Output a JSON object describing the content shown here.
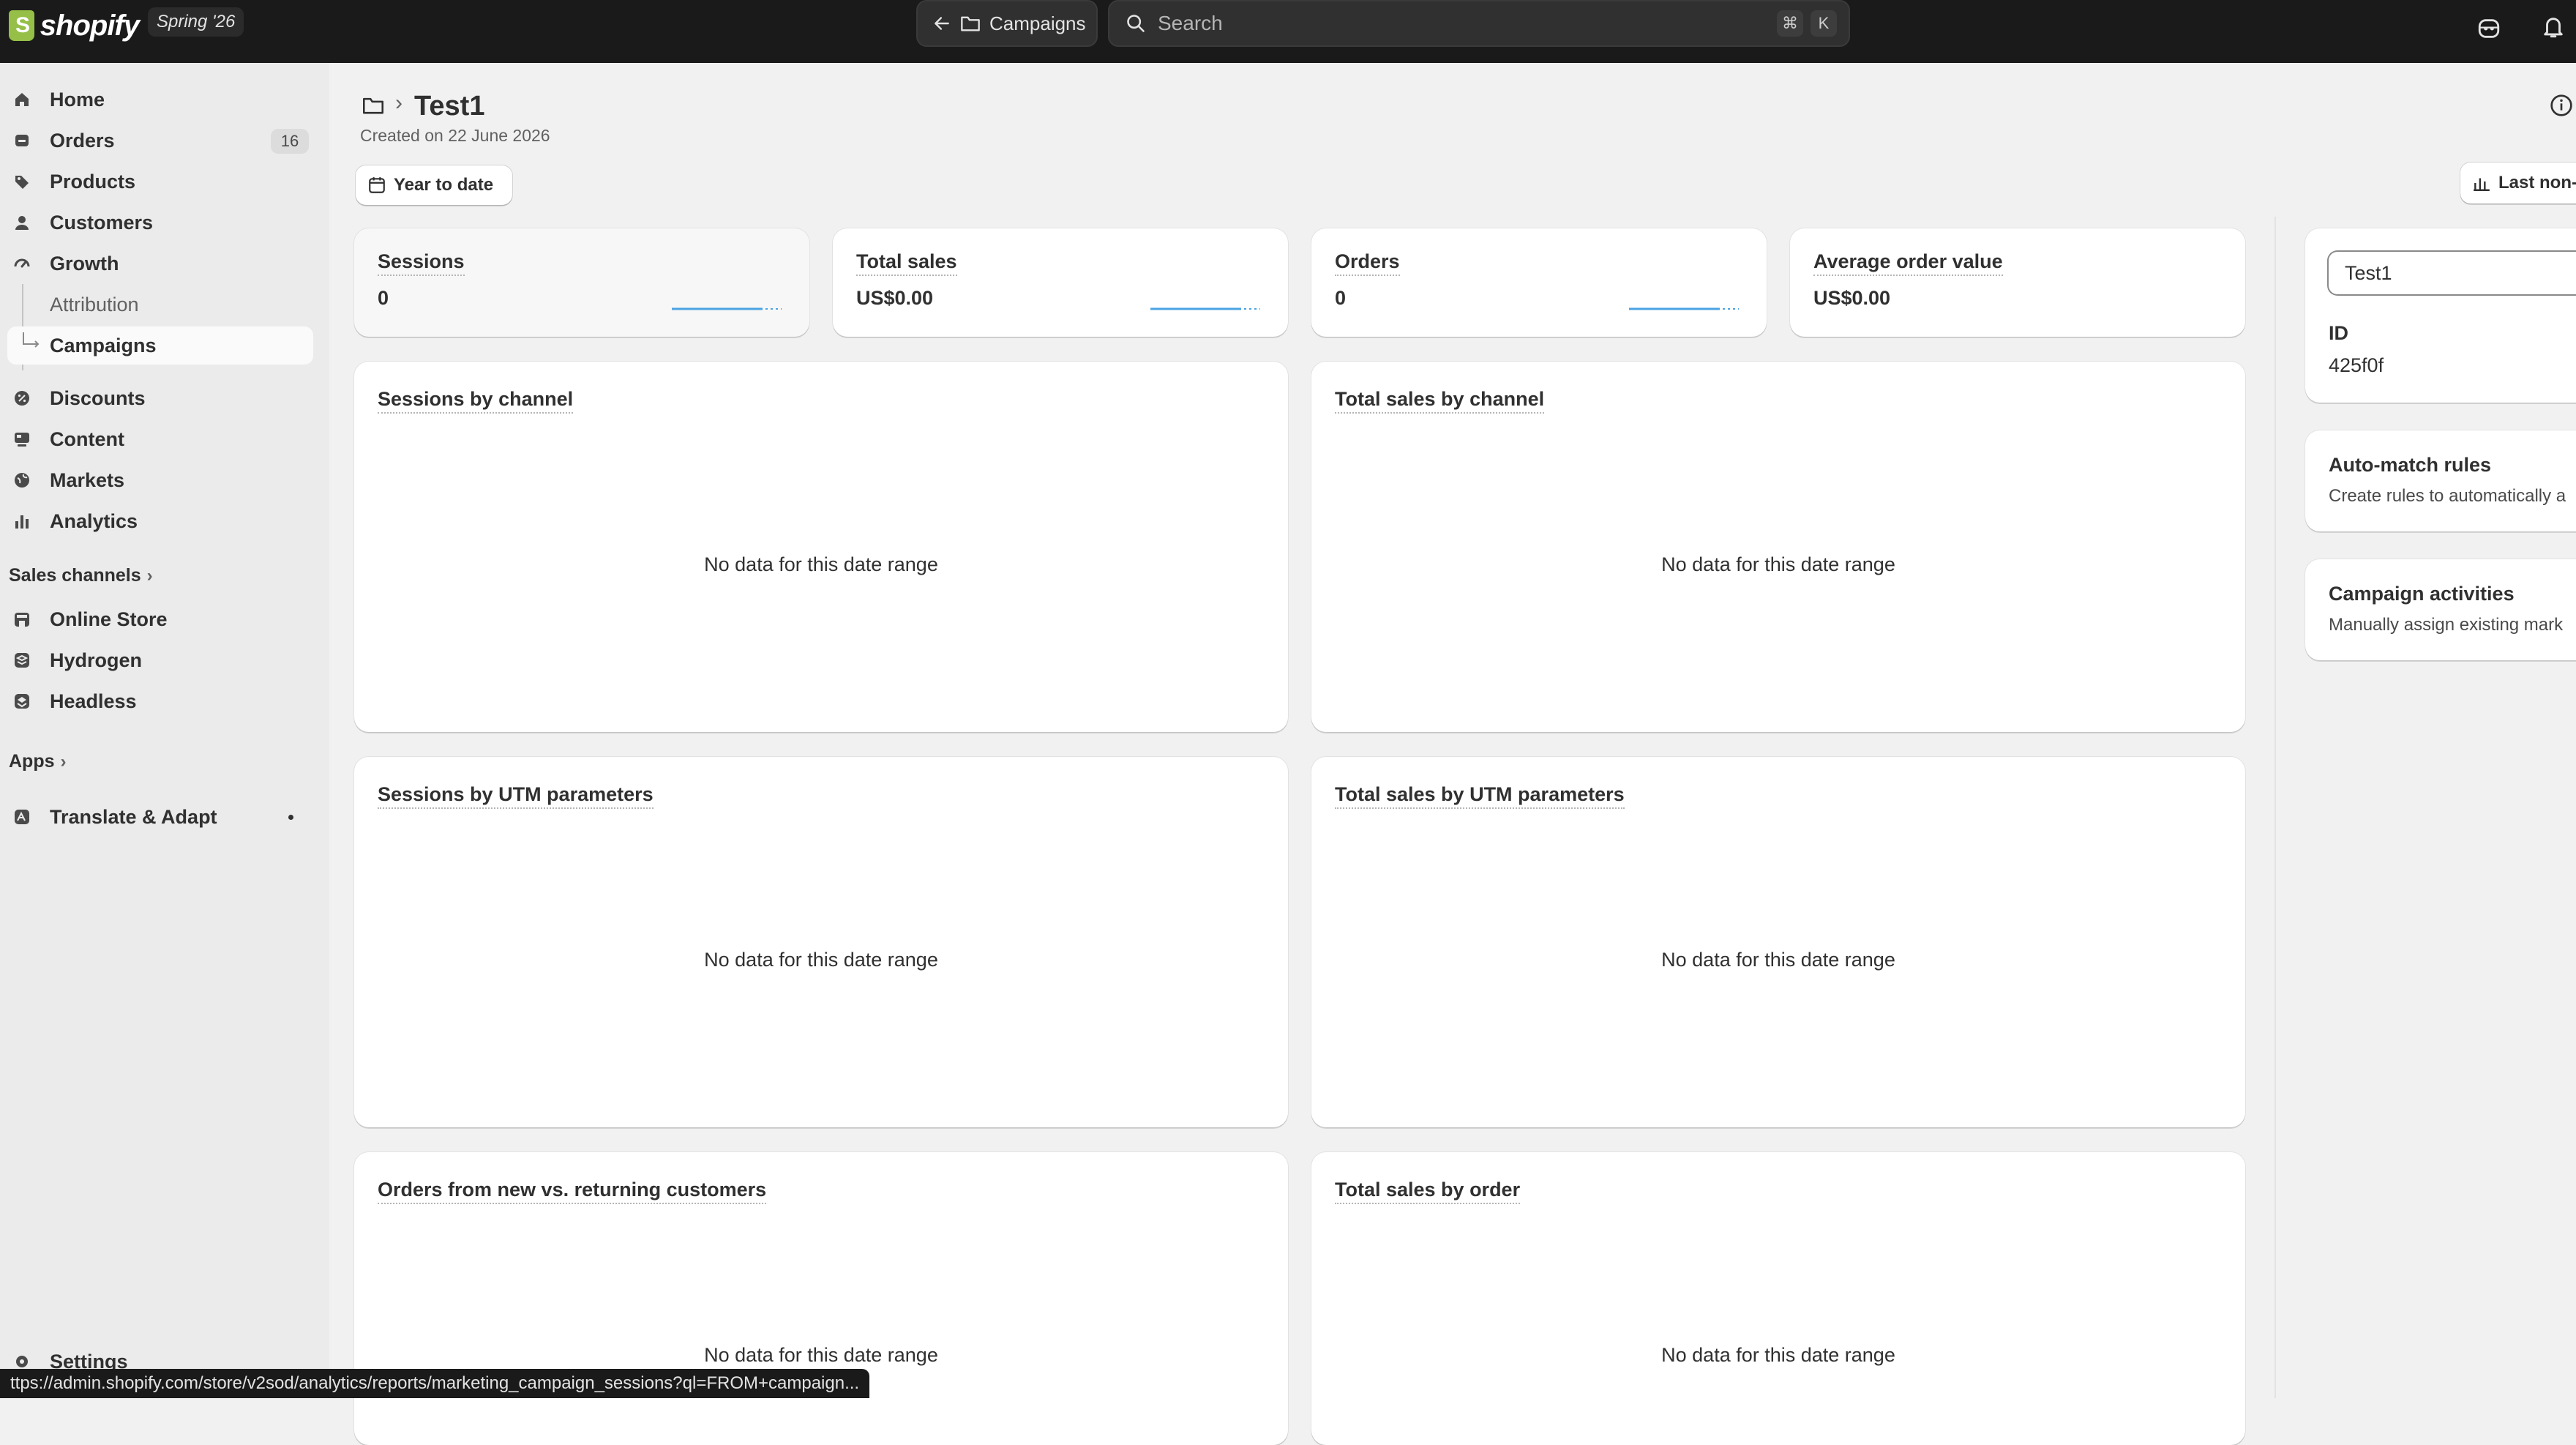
{
  "topbar": {
    "brand": "shopify",
    "edition": "Spring '26",
    "back_label": "Campaigns",
    "search_placeholder": "Search",
    "shortcut_keys": [
      "⌘",
      "K"
    ]
  },
  "sidebar": {
    "items": [
      {
        "label": "Home",
        "icon": "home-icon"
      },
      {
        "label": "Orders",
        "icon": "orders-icon",
        "badge": "16"
      },
      {
        "label": "Products",
        "icon": "tag-icon"
      },
      {
        "label": "Customers",
        "icon": "person-icon"
      },
      {
        "label": "Growth",
        "icon": "gauge-icon"
      },
      {
        "label": "Attribution"
      },
      {
        "label": "Campaigns",
        "active": true
      },
      {
        "label": "Discounts",
        "icon": "discount-icon"
      },
      {
        "label": "Content",
        "icon": "content-icon"
      },
      {
        "label": "Markets",
        "icon": "globe-icon"
      },
      {
        "label": "Analytics",
        "icon": "bar-chart-icon"
      }
    ],
    "sales_channels_label": "Sales channels",
    "sales_channels": [
      {
        "label": "Online Store",
        "icon": "store-icon"
      },
      {
        "label": "Hydrogen",
        "icon": "hydrogen-icon"
      },
      {
        "label": "Headless",
        "icon": "headless-icon"
      }
    ],
    "apps_label": "Apps",
    "apps": [
      {
        "label": "Translate & Adapt",
        "icon": "translate-icon"
      }
    ],
    "settings_label": "Settings"
  },
  "page": {
    "title": "Test1",
    "created": "Created on 22 June 2026",
    "date_filter": "Year to date",
    "attribution_button": "Last non-"
  },
  "metrics": [
    {
      "title": "Sessions",
      "value": "0"
    },
    {
      "title": "Total sales",
      "value": "US$0.00"
    },
    {
      "title": "Orders",
      "value": "0"
    },
    {
      "title": "Average order value",
      "value": "US$0.00"
    }
  ],
  "reports": [
    {
      "title": "Sessions by channel",
      "empty": "No data for this date range"
    },
    {
      "title": "Total sales by channel",
      "empty": "No data for this date range"
    },
    {
      "title": "Sessions by UTM parameters",
      "empty": "No data for this date range"
    },
    {
      "title": "Total sales by UTM parameters",
      "empty": "No data for this date range"
    },
    {
      "title": "Orders from new vs. returning customers",
      "empty": "No data for this date range"
    },
    {
      "title": "Total sales by order",
      "empty": "No data for this date range"
    }
  ],
  "right_panel": {
    "name_value": "Test1",
    "id_label": "ID",
    "id_value": "425f0f",
    "auto_match_title": "Auto-match rules",
    "auto_match_desc": "Create rules to automatically a",
    "activities_title": "Campaign activities",
    "activities_desc": "Manually assign existing mark"
  },
  "status_url": "ttps://admin.shopify.com/store/v2sod/analytics/reports/marketing_campaign_sessions?ql=FROM+campaign..."
}
